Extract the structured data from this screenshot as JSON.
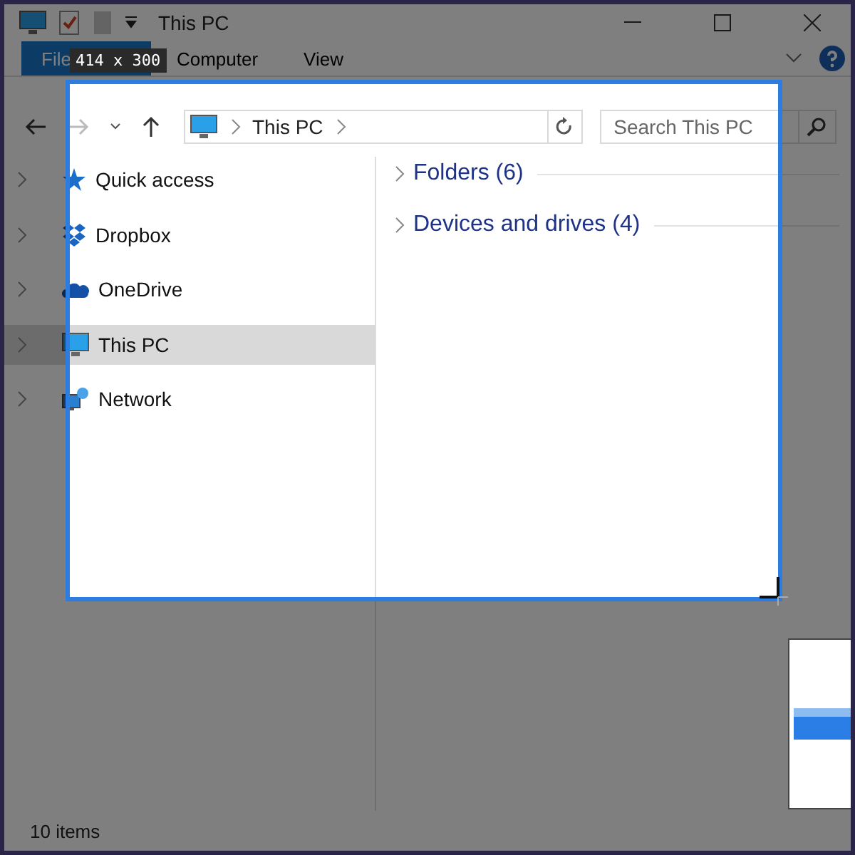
{
  "window": {
    "title": "This PC"
  },
  "ribbon_tabs": [
    {
      "label": "File",
      "selected": true
    },
    {
      "label": "Computer",
      "selected": false
    },
    {
      "label": "View",
      "selected": false
    }
  ],
  "address_bar": {
    "path": [
      "This PC"
    ]
  },
  "search": {
    "placeholder": "Search This PC"
  },
  "nav_items": [
    {
      "label": "Quick access",
      "kind": "star",
      "selected": false
    },
    {
      "label": "Dropbox",
      "kind": "box",
      "selected": false
    },
    {
      "label": "OneDrive",
      "kind": "cloud",
      "selected": false
    },
    {
      "label": "This PC",
      "kind": "computer",
      "selected": true
    },
    {
      "label": "Network",
      "kind": "network",
      "selected": false
    }
  ],
  "groups": [
    {
      "label": "Folders (6)",
      "expanded": false
    },
    {
      "label": "Devices and drives (4)",
      "expanded": false
    }
  ],
  "status_bar": {
    "text": "10 items"
  },
  "capture": {
    "size_label": "414 x 300"
  }
}
